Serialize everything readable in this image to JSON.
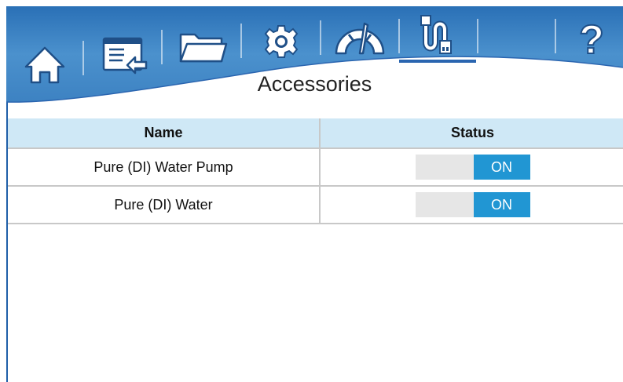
{
  "app": {
    "page_title": "Accessories",
    "accent_color": "#2196d3",
    "header_color": "#3f86c4"
  },
  "nav": {
    "items": [
      {
        "icon": "home-icon"
      },
      {
        "icon": "screen-import-icon"
      },
      {
        "icon": "folder-icon"
      },
      {
        "icon": "gear-icon"
      },
      {
        "icon": "gauge-icon"
      },
      {
        "icon": "usb-cable-icon",
        "active": true
      },
      {
        "icon": "blank"
      },
      {
        "icon": "help-icon",
        "text": "?"
      }
    ]
  },
  "table": {
    "headers": {
      "name": "Name",
      "status": "Status"
    },
    "rows": [
      {
        "name": "Pure (DI) Water Pump",
        "status": "ON"
      },
      {
        "name": "Pure (DI) Water",
        "status": "ON"
      }
    ]
  }
}
